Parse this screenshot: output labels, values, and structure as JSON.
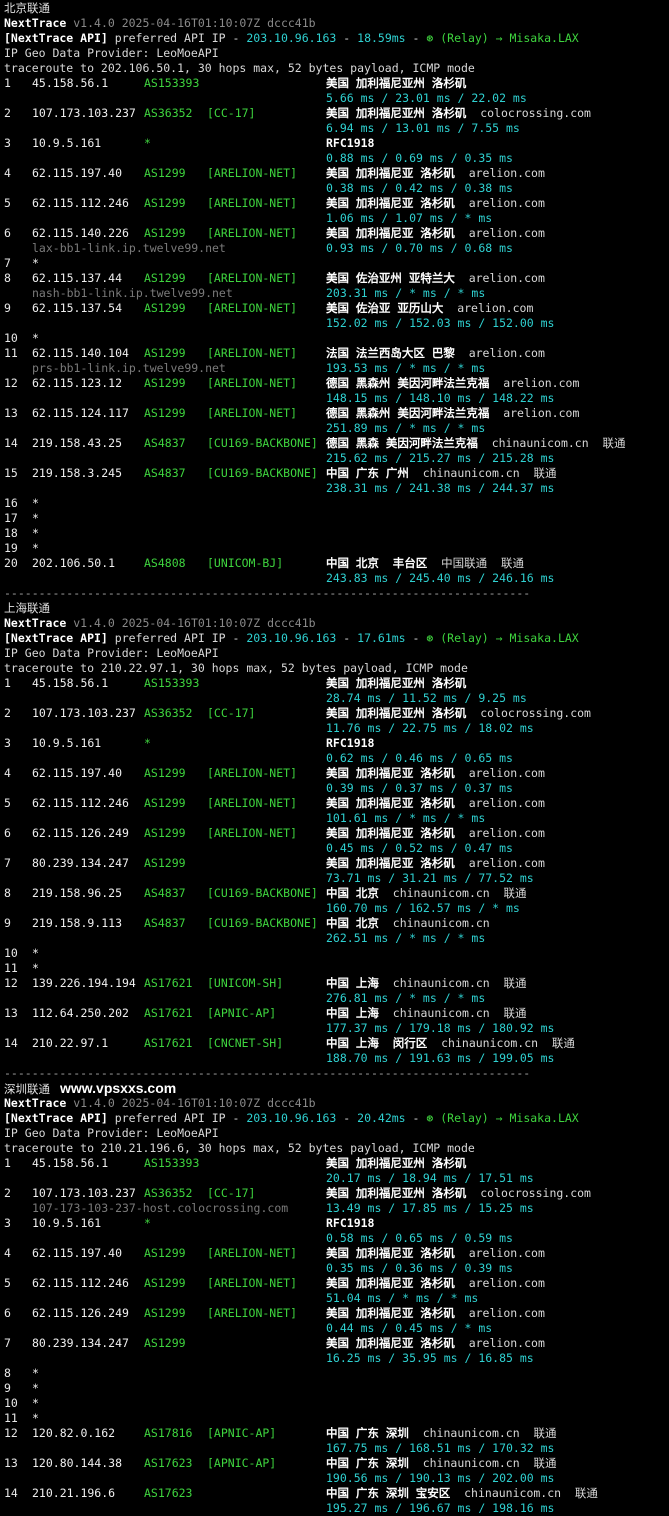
{
  "version_suffix": "v1.4.0 2025-04-16T01:10:07Z dccc41b",
  "provider_line": "IP Geo Data Provider: LeoMoeAPI",
  "separator": "----------------------------------------------------------------------------",
  "site_watermark": "www.vpsxxs.com",
  "sections": [
    {
      "title": "北京联通",
      "api_ip": "203.10.96.163",
      "api_latency": "18.59ms",
      "relay": "(Relay) → Misaka.LAX",
      "traceroute": "traceroute to 202.106.50.1, 30 hops max, 52 bytes payload, ICMP mode",
      "hops": [
        {
          "n": "1",
          "ip": "45.158.56.1",
          "asn": "AS153393",
          "tag": "",
          "loc": "美国 加利福尼亚州 洛杉矶",
          "org": "",
          "rtt": "5.66 ms / 23.01 ms / 22.02 ms"
        },
        {
          "n": "2",
          "ip": "107.173.103.237",
          "asn": "AS36352",
          "tag": "[CC-17]",
          "loc": "美国 加利福尼亚州 洛杉矶",
          "org": "colocrossing.com",
          "rtt": "6.94 ms / 13.01 ms / 7.55 ms"
        },
        {
          "n": "3",
          "ip": "10.9.5.161",
          "asn": "*",
          "tag": "",
          "loc": "RFC1918",
          "org": "",
          "rtt": "0.88 ms / 0.69 ms / 0.35 ms"
        },
        {
          "n": "4",
          "ip": "62.115.197.40",
          "asn": "AS1299",
          "tag": "[ARELION-NET]",
          "loc": "美国 加利福尼亚 洛杉矶",
          "org": "arelion.com",
          "rtt": "0.38 ms / 0.42 ms / 0.38 ms"
        },
        {
          "n": "5",
          "ip": "62.115.112.246",
          "asn": "AS1299",
          "tag": "[ARELION-NET]",
          "loc": "美国 加利福尼亚 洛杉矶",
          "org": "arelion.com",
          "rtt": "1.06 ms / 1.07 ms / * ms"
        },
        {
          "n": "6",
          "ip": "62.115.140.226",
          "asn": "AS1299",
          "tag": "[ARELION-NET]",
          "loc": "美国 加利福尼亚 洛杉矶",
          "org": "arelion.com",
          "rdns": "lax-bb1-link.ip.twelve99.net",
          "rtt": "0.93 ms / 0.70 ms / 0.68 ms"
        },
        {
          "n": "7",
          "star": true
        },
        {
          "n": "8",
          "ip": "62.115.137.44",
          "asn": "AS1299",
          "tag": "[ARELION-NET]",
          "loc": "美国 佐治亚州 亚特兰大",
          "org": "arelion.com",
          "rdns": "nash-bb1-link.ip.twelve99.net",
          "rtt": "203.31 ms / * ms / * ms"
        },
        {
          "n": "9",
          "ip": "62.115.137.54",
          "asn": "AS1299",
          "tag": "[ARELION-NET]",
          "loc": "美国 佐治亚 亚历山大",
          "org": "arelion.com",
          "rtt": "152.02 ms / 152.03 ms / 152.00 ms"
        },
        {
          "n": "10",
          "star": true
        },
        {
          "n": "11",
          "ip": "62.115.140.104",
          "asn": "AS1299",
          "tag": "[ARELION-NET]",
          "loc": "法国 法兰西岛大区 巴黎",
          "org": "arelion.com",
          "rdns": "prs-bb1-link.ip.twelve99.net",
          "rtt": "193.53 ms / * ms / * ms"
        },
        {
          "n": "12",
          "ip": "62.115.123.12",
          "asn": "AS1299",
          "tag": "[ARELION-NET]",
          "loc": "德国 黑森州 美因河畔法兰克福",
          "org": "arelion.com",
          "rtt": "148.15 ms / 148.10 ms / 148.22 ms"
        },
        {
          "n": "13",
          "ip": "62.115.124.117",
          "asn": "AS1299",
          "tag": "[ARELION-NET]",
          "loc": "德国 黑森州 美因河畔法兰克福",
          "org": "arelion.com",
          "rtt": "251.89 ms / * ms / * ms"
        },
        {
          "n": "14",
          "ip": "219.158.43.25",
          "asn": "AS4837",
          "tag": "[CU169-BACKBONE]",
          "loc": "德国 黑森 美因河畔法兰克福",
          "org": "chinaunicom.cn  联通",
          "rtt": "215.62 ms / 215.27 ms / 215.28 ms"
        },
        {
          "n": "15",
          "ip": "219.158.3.245",
          "asn": "AS4837",
          "tag": "[CU169-BACKBONE]",
          "loc": "中国 广东 广州",
          "org": "chinaunicom.cn  联通",
          "rtt": "238.31 ms / 241.38 ms / 244.37 ms"
        },
        {
          "n": "16",
          "star": true
        },
        {
          "n": "17",
          "star": true
        },
        {
          "n": "18",
          "star": true
        },
        {
          "n": "19",
          "star": true
        },
        {
          "n": "20",
          "ip": "202.106.50.1",
          "asn": "AS4808",
          "tag": "[UNICOM-BJ]",
          "loc": "中国 北京  丰台区",
          "org": "中国联通  联通",
          "rtt": "243.83 ms / 245.40 ms / 246.16 ms"
        }
      ]
    },
    {
      "title": "上海联通",
      "api_ip": "203.10.96.163",
      "api_latency": "17.61ms",
      "relay": "(Relay) → Misaka.LAX",
      "traceroute": "traceroute to 210.22.97.1, 30 hops max, 52 bytes payload, ICMP mode",
      "hops": [
        {
          "n": "1",
          "ip": "45.158.56.1",
          "asn": "AS153393",
          "tag": "",
          "loc": "美国 加利福尼亚州 洛杉矶",
          "org": "",
          "rtt": "28.74 ms / 11.52 ms / 9.25 ms"
        },
        {
          "n": "2",
          "ip": "107.173.103.237",
          "asn": "AS36352",
          "tag": "[CC-17]",
          "loc": "美国 加利福尼亚州 洛杉矶",
          "org": "colocrossing.com",
          "rtt": "11.76 ms / 22.75 ms / 18.02 ms"
        },
        {
          "n": "3",
          "ip": "10.9.5.161",
          "asn": "*",
          "tag": "",
          "loc": "RFC1918",
          "org": "",
          "rtt": "0.62 ms / 0.46 ms / 0.65 ms"
        },
        {
          "n": "4",
          "ip": "62.115.197.40",
          "asn": "AS1299",
          "tag": "[ARELION-NET]",
          "loc": "美国 加利福尼亚 洛杉矶",
          "org": "arelion.com",
          "rtt": "0.39 ms / 0.37 ms / 0.37 ms"
        },
        {
          "n": "5",
          "ip": "62.115.112.246",
          "asn": "AS1299",
          "tag": "[ARELION-NET]",
          "loc": "美国 加利福尼亚 洛杉矶",
          "org": "arelion.com",
          "rtt": "101.61 ms / * ms / * ms"
        },
        {
          "n": "6",
          "ip": "62.115.126.249",
          "asn": "AS1299",
          "tag": "[ARELION-NET]",
          "loc": "美国 加利福尼亚 洛杉矶",
          "org": "arelion.com",
          "rtt": "0.45 ms / 0.52 ms / 0.47 ms"
        },
        {
          "n": "7",
          "ip": "80.239.134.247",
          "asn": "AS1299",
          "tag": "",
          "loc": "美国 加利福尼亚 洛杉矶",
          "org": "arelion.com",
          "rtt": "73.71 ms / 31.21 ms / 77.52 ms"
        },
        {
          "n": "8",
          "ip": "219.158.96.25",
          "asn": "AS4837",
          "tag": "[CU169-BACKBONE]",
          "loc": "中国 北京",
          "org": "chinaunicom.cn  联通",
          "rtt": "160.70 ms / 162.57 ms / * ms"
        },
        {
          "n": "9",
          "ip": "219.158.9.113",
          "asn": "AS4837",
          "tag": "[CU169-BACKBONE]",
          "loc": "中国 北京",
          "org": "chinaunicom.cn",
          "rtt": "262.51 ms / * ms / * ms"
        },
        {
          "n": "10",
          "star": true
        },
        {
          "n": "11",
          "star": true
        },
        {
          "n": "12",
          "ip": "139.226.194.194",
          "asn": "AS17621",
          "tag": "[UNICOM-SH]",
          "loc": "中国 上海",
          "org": "chinaunicom.cn  联通",
          "rtt": "276.81 ms / * ms / * ms"
        },
        {
          "n": "13",
          "ip": "112.64.250.202",
          "asn": "AS17621",
          "tag": "[APNIC-AP]",
          "loc": "中国 上海",
          "org": "chinaunicom.cn  联通",
          "rtt": "177.37 ms / 179.18 ms / 180.92 ms"
        },
        {
          "n": "14",
          "ip": "210.22.97.1",
          "asn": "AS17621",
          "tag": "[CNCNET-SH]",
          "loc": "中国 上海  闵行区",
          "org": "chinaunicom.cn  联通",
          "rtt": "188.70 ms / 191.63 ms / 199.05 ms"
        }
      ]
    },
    {
      "title": "深圳联通",
      "api_ip": "203.10.96.163",
      "api_latency": "20.42ms",
      "relay": "(Relay) → Misaka.LAX",
      "traceroute": "traceroute to 210.21.196.6, 30 hops max, 52 bytes payload, ICMP mode",
      "hops": [
        {
          "n": "1",
          "ip": "45.158.56.1",
          "asn": "AS153393",
          "tag": "",
          "loc": "美国 加利福尼亚州 洛杉矶",
          "org": "",
          "rtt": "20.17 ms / 18.94 ms / 17.51 ms"
        },
        {
          "n": "2",
          "ip": "107.173.103.237",
          "asn": "AS36352",
          "tag": "[CC-17]",
          "loc": "美国 加利福尼亚州 洛杉矶",
          "org": "colocrossing.com",
          "rdns": "107-173-103-237-host.colocrossing.com",
          "rtt": "13.49 ms / 17.85 ms / 15.25 ms"
        },
        {
          "n": "3",
          "ip": "10.9.5.161",
          "asn": "*",
          "tag": "",
          "loc": "RFC1918",
          "org": "",
          "rtt": "0.58 ms / 0.65 ms / 0.59 ms"
        },
        {
          "n": "4",
          "ip": "62.115.197.40",
          "asn": "AS1299",
          "tag": "[ARELION-NET]",
          "loc": "美国 加利福尼亚 洛杉矶",
          "org": "arelion.com",
          "rtt": "0.35 ms / 0.36 ms / 0.39 ms"
        },
        {
          "n": "5",
          "ip": "62.115.112.246",
          "asn": "AS1299",
          "tag": "[ARELION-NET]",
          "loc": "美国 加利福尼亚 洛杉矶",
          "org": "arelion.com",
          "rtt": "51.04 ms / * ms / * ms"
        },
        {
          "n": "6",
          "ip": "62.115.126.249",
          "asn": "AS1299",
          "tag": "[ARELION-NET]",
          "loc": "美国 加利福尼亚 洛杉矶",
          "org": "arelion.com",
          "rtt": "0.44 ms / 0.45 ms / * ms"
        },
        {
          "n": "7",
          "ip": "80.239.134.247",
          "asn": "AS1299",
          "tag": "",
          "loc": "美国 加利福尼亚 洛杉矶",
          "org": "arelion.com",
          "rtt": "16.25 ms / 35.95 ms / 16.85 ms"
        },
        {
          "n": "8",
          "star": true
        },
        {
          "n": "9",
          "star": true
        },
        {
          "n": "10",
          "star": true
        },
        {
          "n": "11",
          "star": true
        },
        {
          "n": "12",
          "ip": "120.82.0.162",
          "asn": "AS17816",
          "tag": "[APNIC-AP]",
          "loc": "中国 广东 深圳",
          "org": "chinaunicom.cn  联通",
          "rtt": "167.75 ms / 168.51 ms / 170.32 ms"
        },
        {
          "n": "13",
          "ip": "120.80.144.38",
          "asn": "AS17623",
          "tag": "[APNIC-AP]",
          "loc": "中国 广东 深圳",
          "org": "chinaunicom.cn  联通",
          "rtt": "190.56 ms / 190.13 ms / 202.00 ms"
        },
        {
          "n": "14",
          "ip": "210.21.196.6",
          "asn": "AS17623",
          "tag": "",
          "loc": "中国 广东 深圳 宝安区",
          "org": "chinaunicom.cn  联通",
          "rtt": "195.27 ms / 196.67 ms / 198.16 ms"
        }
      ]
    }
  ]
}
